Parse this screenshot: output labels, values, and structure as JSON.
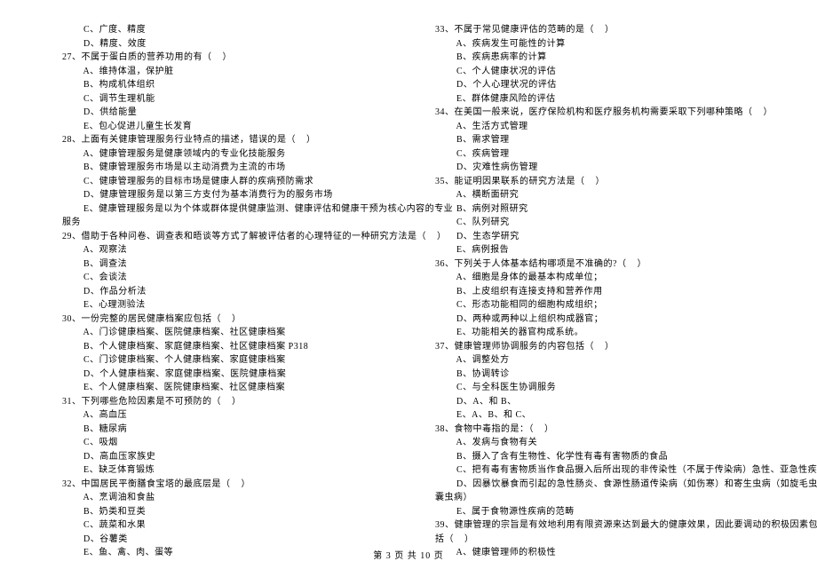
{
  "footer": "第 3 页  共 10 页",
  "left": [
    "        C、广度、精度",
    "        D、精度、效度",
    "27、不属于蛋白质的营养功用的有（    ）",
    "        A、维持体温，保护脏",
    "        B、构成机体组织",
    "        C、调节生理机能",
    "        D、供给能量",
    "        E、包心促进儿童生长发育",
    "28、上面有关健康管理服务行业特点的描述，错误的是（    ）",
    "        A、健康管理服务是健康领域内的专业化技能服务",
    "        B、健康管理服务市场是以主动消费为主流的市场",
    "        C、健康管理服务的目标市场是健康人群的疾病预防需求",
    "        D、健康管理服务是以第三方支付为基本消费行为的服务市场",
    "        E、健康管理服务是以为个体或群体提供健康监测、健康评估和健康干预为核心内容的专业",
    "服务",
    "29、借助于各种问卷、调查表和晤谈等方式了解被评估者的心理特征的一种研究方法是（    ）",
    "        A、观察法",
    "        B、调查法",
    "        C、会谈法",
    "        D、作品分析法",
    "        E、心理测验法",
    "30、一份完整的居民健康档案应包括（    ）",
    "        A、门诊健康档案、医院健康档案、社区健康档案",
    "        B、个人健康档案、家庭健康档案、社区健康档案 P318",
    "        C、门诊健康档案、个人健康档案、家庭健康档案",
    "        D、个人健康档案、家庭健康档案、医院健康档案",
    "        E、个人健康档案、医院健康档案、社区健康档案",
    "31、下列哪些危险因素是不可预防的（    ）",
    "        A、高血压",
    "        B、糖尿病",
    "        C、吸烟",
    "        D、高血压家族史",
    "        E、缺乏体育锻炼",
    "32、中国居民平衡膳食宝塔的最底层是（    ）",
    "        A、烹调油和食盐",
    "        B、奶类和豆类",
    "        C、蔬菜和水果",
    "        D、谷薯类",
    "        E、鱼、禽、肉、蛋等"
  ],
  "right": [
    "33、不属于常见健康评估的范畴的是（    ）",
    "        A、疾病发生可能性的计算",
    "        B、疾病患病率的计算",
    "        C、个人健康状况的评估",
    "        D、个人心理状况的评估",
    "        E、群体健康风险的评估",
    "34、在美国一般来说，医疗保险机构和医疗服务机构需要采取下列哪种策略（    ）",
    "        A、生活方式管理",
    "        B、需求管理",
    "        C、疾病管理",
    "        D、灾难性病伤管理",
    "35、能证明因果联系的研究方法是（    ）",
    "        A、横断面研究",
    "        B、病例对照研究",
    "        C、队列研究",
    "        D、生态学研究",
    "        E、病例报告",
    "36、下列关于人体基本结构哪项是不准确的?（    ）",
    "        A、细胞是身体的最基本构成单位；",
    "        B、上皮组织有连接支持和营养作用",
    "        C、形态功能相同的细胞构成组织；",
    "        D、两种或两种以上组织构成器官；",
    "        E、功能相关的器官构成系统。",
    "37、健康管理师协调服务的内容包括（    ）",
    "        A、调整处方",
    "        B、协调转诊",
    "        C、与全科医生协调服务",
    "        D、A、和 B、",
    "        E、A、B、和 C、",
    "38、食物中毒指的是：（    ）",
    "        A、发病与食物有关",
    "        B、摄入了含有生物性、化学性有毒有害物质的食品",
    "        C、把有毒有害物质当作食品摄入后所出现的非传染性（不属于传染病）急性、亚急性疾病",
    "        D、因暴饮暴食而引起的急性肠炎、食源性肠道传染病（如伤寒）和寄生虫病（如旋毛虫、",
    "囊虫病）",
    "        E、属于食物源性疾病的范畴",
    "39、健康管理的宗旨是有效地利用有限资源来达到最大的健康效果，因此要调动的积极因素包",
    "括（    ）",
    "        A、健康管理师的积极性"
  ]
}
